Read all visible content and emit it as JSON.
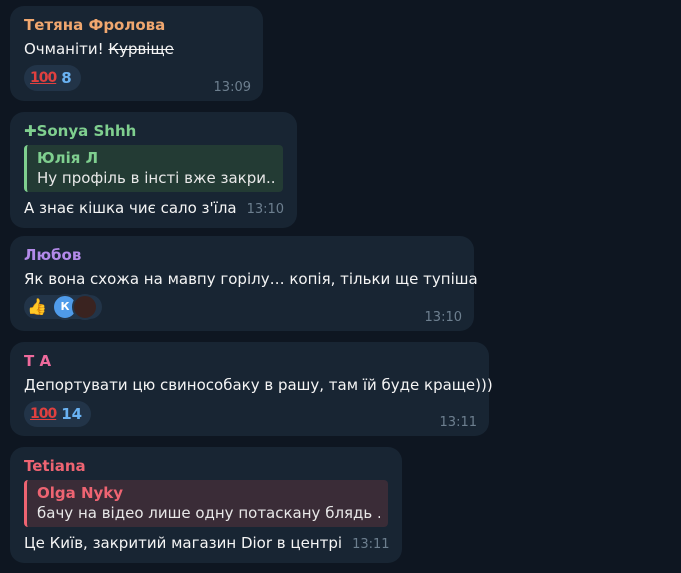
{
  "colors": {
    "background": "#0e1621",
    "bubble": "#182533",
    "time": "#6d7f8f",
    "reaction_count": "#6ab2f2"
  },
  "messages": [
    {
      "sender": "Тетяна Фролова",
      "sender_color": "#f0a76f",
      "text_plain": "Очманіти! ",
      "text_strike": "Курвіще",
      "reaction": {
        "emoji_icon": "hundred-points-icon",
        "emoji": "100",
        "count": "8"
      },
      "time": "13:09"
    },
    {
      "sender": "✚Sonya Shhh",
      "sender_color": "#7fcf8f",
      "reply": {
        "name": "Юлія Л",
        "text": "Ну профіль в інсті вже закри...",
        "color": "#7fcf8f"
      },
      "text": "А знає кішка чиє сало з'їла",
      "time": "13:10"
    },
    {
      "sender": "Любов",
      "sender_color": "#b38ae9",
      "text": "Як вона схожа на мавпу горілу… копія, тільки  ще тупіша",
      "reaction": {
        "emoji_icon": "thumbs-up-icon",
        "avatar_letter": "К"
      },
      "time": "13:10"
    },
    {
      "sender": "T A",
      "sender_color": "#ee6a9c",
      "text": "Депортувати цю свинособаку в рашу, там їй буде краще)))",
      "reaction": {
        "emoji_icon": "hundred-points-icon",
        "emoji": "100",
        "count": "14"
      },
      "time": "13:11"
    },
    {
      "sender": "Tetiana",
      "sender_color": "#ee6472",
      "reply": {
        "name": "Olga Nyky",
        "text": "бачу на відео лише одну потаскану блядь ...",
        "color": "#ee6472"
      },
      "text": "Це Київ, закритий магазин Dior в центрі",
      "time": "13:11"
    }
  ]
}
